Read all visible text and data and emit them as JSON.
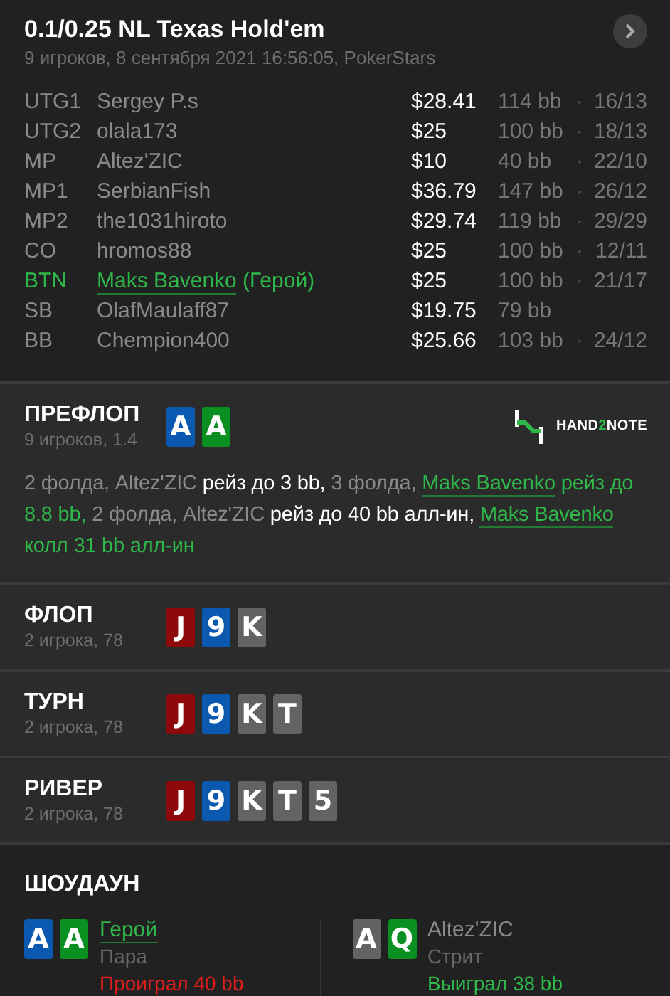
{
  "header": {
    "title": "0.1/0.25 NL Texas Hold'em",
    "subtitle": "9 игроков, 8 сентября 2021 16:56:05, PokerStars"
  },
  "players": [
    {
      "position": "UTG1",
      "name": "Sergey P.s",
      "hero": false,
      "stack": "$28.41",
      "bb": "114 bb",
      "separator": "·",
      "stats": "16/13"
    },
    {
      "position": "UTG2",
      "name": "olala173",
      "hero": false,
      "stack": "$25",
      "bb": "100 bb",
      "separator": "·",
      "stats": "18/13"
    },
    {
      "position": "MP",
      "name": "Altez'ZIC",
      "hero": false,
      "stack": "$10",
      "bb": "40 bb",
      "separator": "·",
      "stats": "22/10"
    },
    {
      "position": "MP1",
      "name": "SerbianFish",
      "hero": false,
      "stack": "$36.79",
      "bb": "147 bb",
      "separator": "·",
      "stats": "26/12"
    },
    {
      "position": "MP2",
      "name": "the1031hiroto",
      "hero": false,
      "stack": "$29.74",
      "bb": "119 bb",
      "separator": "·",
      "stats": "29/29"
    },
    {
      "position": "CO",
      "name": "hromos88",
      "hero": false,
      "stack": "$25",
      "bb": "100 bb",
      "separator": "·",
      "stats": "12/11"
    },
    {
      "position": "BTN",
      "name": "Maks Bavenko",
      "hero": true,
      "hero_tag": "(Герой)",
      "stack": "$25",
      "bb": "100 bb",
      "separator": "·",
      "stats": "21/17"
    },
    {
      "position": "SB",
      "name": "OlafMaulaff87",
      "hero": false,
      "stack": "$19.75",
      "bb": "79 bb"
    },
    {
      "position": "BB",
      "name": "Chempion400",
      "hero": false,
      "stack": "$25.66",
      "bb": "103 bb",
      "separator": "·",
      "stats": "24/12"
    }
  ],
  "logo": {
    "parts": [
      {
        "text": "HAND",
        "accent": false
      },
      {
        "text": "2",
        "accent": true
      },
      {
        "text": "NOTE",
        "accent": false
      }
    ]
  },
  "streets": [
    {
      "title": "ПРЕФЛОП",
      "info": "9 игроков, 1.4",
      "logo": true,
      "cards": [
        {
          "rank": "A",
          "color": "#0b58b0"
        },
        {
          "rank": "A",
          "color": "#0a9020"
        }
      ],
      "actions": [
        {
          "text": "2 фолда, Altez'ZIC ",
          "kind": "muted"
        },
        {
          "text": "рейз до 3 bb,",
          "kind": "action"
        },
        {
          "text": " 3 фолда, ",
          "kind": "muted"
        },
        {
          "text": "Maks Bavenko",
          "kind": "hero-link"
        },
        {
          "text": " рейз до 8.8 bb,",
          "kind": "hero"
        },
        {
          "text": " 2 фолда, Altez'ZIC ",
          "kind": "muted"
        },
        {
          "text": "рейз до 40 bb алл-ин, ",
          "kind": "action"
        },
        {
          "text": "Maks Bavenko",
          "kind": "hero-link"
        },
        {
          "text": " колл 31 bb алл-ин",
          "kind": "hero"
        }
      ]
    },
    {
      "title": "ФЛОП",
      "info": "2 игрока, 78",
      "cards": [
        {
          "rank": "J",
          "color": "#8e0a0a"
        },
        {
          "rank": "9",
          "color": "#0b58b0"
        },
        {
          "rank": "K",
          "color": "#636363"
        }
      ]
    },
    {
      "title": "ТУРН",
      "info": "2 игрока, 78",
      "cards": [
        {
          "rank": "J",
          "color": "#8e0a0a"
        },
        {
          "rank": "9",
          "color": "#0b58b0"
        },
        {
          "rank": "K",
          "color": "#636363"
        },
        {
          "rank": "T",
          "color": "#636363"
        }
      ]
    },
    {
      "title": "РИВЕР",
      "info": "2 игрока, 78",
      "cards": [
        {
          "rank": "J",
          "color": "#8e0a0a"
        },
        {
          "rank": "9",
          "color": "#0b58b0"
        },
        {
          "rank": "K",
          "color": "#636363"
        },
        {
          "rank": "T",
          "color": "#636363"
        },
        {
          "rank": "5",
          "color": "#636363"
        }
      ]
    }
  ],
  "showdown": {
    "title": "ШОУДАУН",
    "players": [
      {
        "name": "Герой",
        "hero": true,
        "hand": "Пара",
        "result": "Проиграл 40 bb",
        "won": false,
        "cards": [
          {
            "rank": "A",
            "color": "#0b58b0"
          },
          {
            "rank": "A",
            "color": "#0a9020"
          }
        ]
      },
      {
        "name": "Altez'ZIC",
        "hero": false,
        "hand": "Стрит",
        "result": "Выиграл 38 bb",
        "won": true,
        "cards": [
          {
            "rank": "A",
            "color": "#636363"
          },
          {
            "rank": "Q",
            "color": "#0a9020"
          }
        ]
      }
    ]
  }
}
